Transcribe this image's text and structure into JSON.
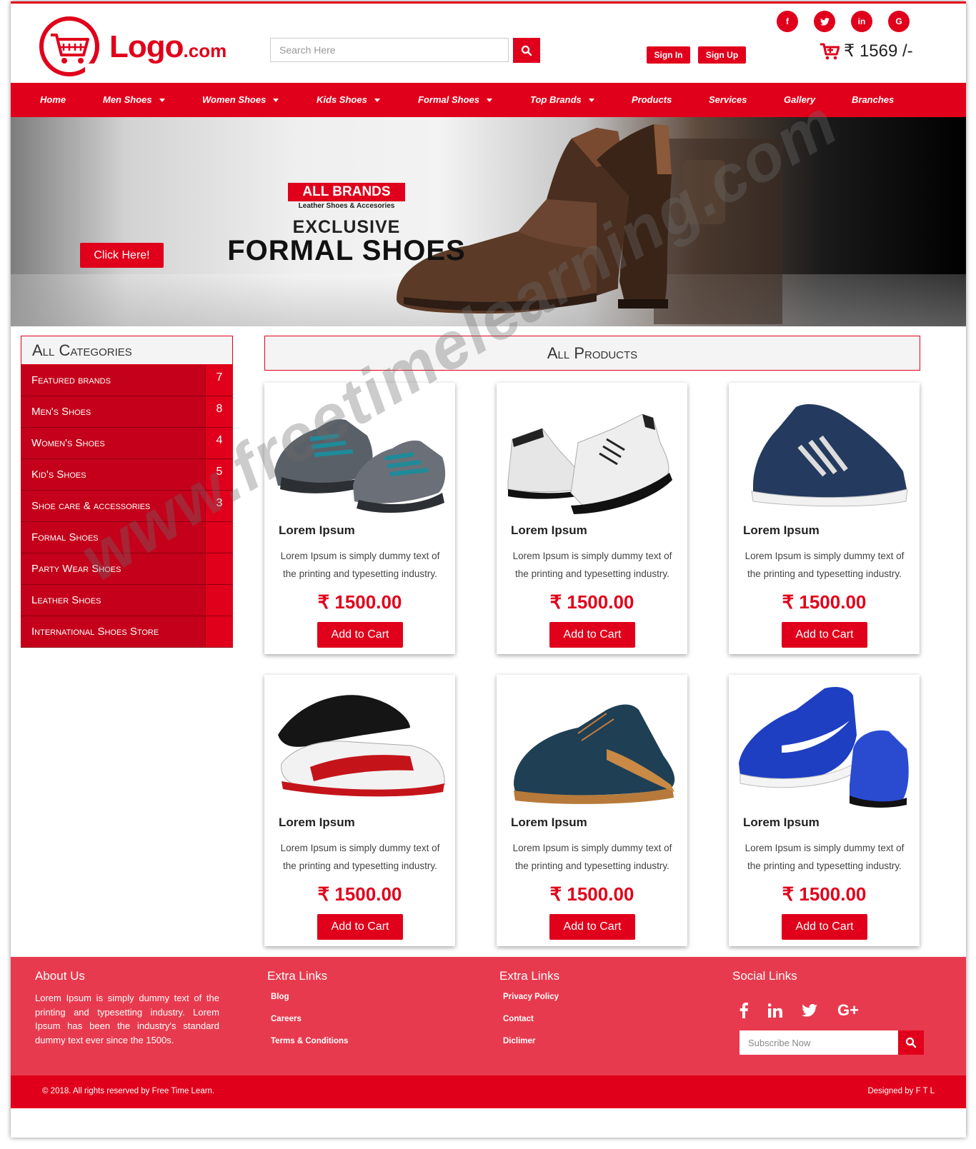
{
  "header": {
    "logo_main": "Logo",
    "logo_suffix": ".com",
    "search_placeholder": "Search Here",
    "sign_in": "Sign In",
    "sign_up": "Sign Up",
    "cart_total": "₹ 1569 /-",
    "social": [
      {
        "icon": "facebook-icon",
        "glyph": "f"
      },
      {
        "icon": "twitter-icon",
        "glyph": "t"
      },
      {
        "icon": "linkedin-icon",
        "glyph": "in"
      },
      {
        "icon": "google-icon",
        "glyph": "G"
      }
    ]
  },
  "nav": {
    "items": [
      {
        "label": "Home",
        "dropdown": false
      },
      {
        "label": "Men Shoes",
        "dropdown": true
      },
      {
        "label": "Women Shoes",
        "dropdown": true
      },
      {
        "label": "Kids Shoes",
        "dropdown": true
      },
      {
        "label": "Formal Shoes",
        "dropdown": true
      },
      {
        "label": "Top Brands",
        "dropdown": true
      },
      {
        "label": "Products",
        "dropdown": false
      },
      {
        "label": "Services",
        "dropdown": false
      },
      {
        "label": "Gallery",
        "dropdown": false
      },
      {
        "label": "Branches",
        "dropdown": false
      }
    ]
  },
  "banner": {
    "button": "Click Here!",
    "badge": "ALL BRANDS",
    "tagline": "Leather Shoes & Accesories",
    "line1": "EXCLUSIVE",
    "line2": "FORMAL SHOES"
  },
  "sidebar": {
    "title": "All Categories",
    "items": [
      {
        "label": "Featured brands",
        "count": "7"
      },
      {
        "label": "Men's Shoes",
        "count": "8"
      },
      {
        "label": "Women's Shoes",
        "count": "4"
      },
      {
        "label": "Kid's Shoes",
        "count": "5"
      },
      {
        "label": "Shoe care & accessories",
        "count": "3"
      },
      {
        "label": "Formal Shoes",
        "count": ""
      },
      {
        "label": "Party Wear Shoes",
        "count": ""
      },
      {
        "label": "Leather Shoes",
        "count": ""
      },
      {
        "label": "International Shoes Store",
        "count": ""
      }
    ]
  },
  "products": {
    "title": "All Products",
    "items": [
      {
        "name": "Lorem Ipsum",
        "desc": "Lorem Ipsum is simply dummy text of the printing and typesetting industry.",
        "price": "₹ 1500.00",
        "button": "Add to Cart"
      },
      {
        "name": "Lorem Ipsum",
        "desc": "Lorem Ipsum is simply dummy text of the printing and typesetting industry.",
        "price": "₹ 1500.00",
        "button": "Add to Cart"
      },
      {
        "name": "Lorem Ipsum",
        "desc": "Lorem Ipsum is simply dummy text of the printing and typesetting industry.",
        "price": "₹ 1500.00",
        "button": "Add to Cart"
      },
      {
        "name": "Lorem Ipsum",
        "desc": "Lorem Ipsum is simply dummy text of the printing and typesetting industry.",
        "price": "₹ 1500.00",
        "button": "Add to Cart"
      },
      {
        "name": "Lorem Ipsum",
        "desc": "Lorem Ipsum is simply dummy text of the printing and typesetting industry.",
        "price": "₹ 1500.00",
        "button": "Add to Cart"
      },
      {
        "name": "Lorem Ipsum",
        "desc": "Lorem Ipsum is simply dummy text of the printing and typesetting industry.",
        "price": "₹ 1500.00",
        "button": "Add to Cart"
      }
    ]
  },
  "watermark": "www.freetimelearning.com",
  "footer": {
    "about_title": "About Us",
    "about_text": "Lorem Ipsum is simply dummy text of the printing and typesetting industry. Lorem Ipsum has been the industry's standard dummy text ever since the 1500s.",
    "links1_title": "Extra Links",
    "links1": [
      "Blog",
      "Careers",
      "Terms & Conditions"
    ],
    "links2_title": "Extra Links",
    "links2": [
      "Privacy Policy",
      "Contact",
      "Diclimer"
    ],
    "social_title": "Social Links",
    "subscribe_placeholder": "Subscribe Now",
    "copyright": "© 2018. All rights reserved by Free Time Learn.",
    "designed": "Designed by F T L"
  },
  "colors": {
    "brand": "#e0001b",
    "footer": "#e83a4e",
    "sidebar": "#c4001a"
  }
}
